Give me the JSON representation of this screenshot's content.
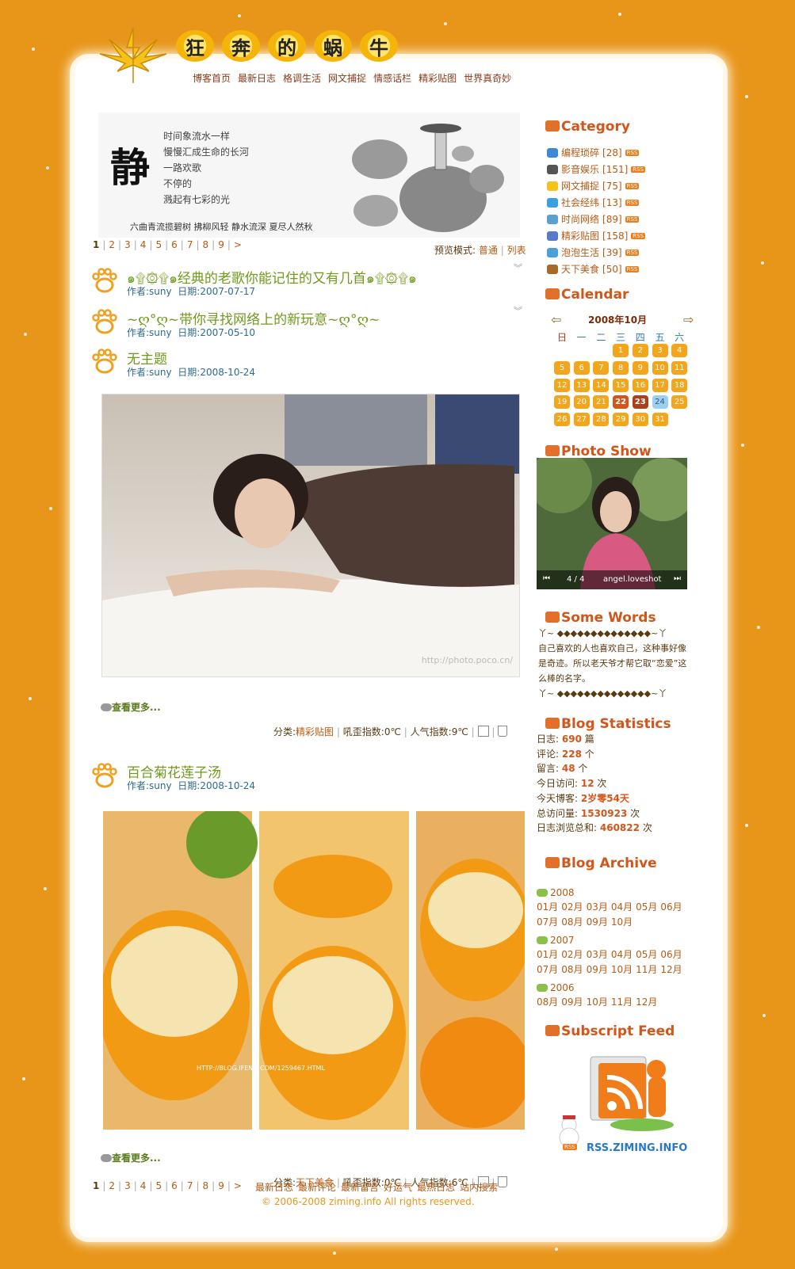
{
  "site": {
    "title_chars": [
      "狂",
      "奔",
      "的",
      "蜗",
      "牛"
    ],
    "nav": [
      "博客首页",
      "最新日志",
      "格调生活",
      "网文捕捉",
      "情感话栏",
      "精彩贴图",
      "世界真奇妙"
    ]
  },
  "banner": {
    "big_char": "静",
    "poem": "时间象流水一样\n慢慢汇成生命的长河\n一路欢歌\n不停的\n溅起有七彩的光",
    "footer": "六曲青流揽碧树  拂柳风轻  静水流深  夏尽人然秋"
  },
  "pager_top": {
    "pages": [
      "1",
      "2",
      "3",
      "4",
      "5",
      "6",
      "7",
      "8",
      "9",
      ">"
    ],
    "active": "1"
  },
  "view_mode": {
    "label": "预览模式:",
    "normal": "普通",
    "list": "列表"
  },
  "posts": [
    {
      "title": "๑۩۞۩๑经典的老歌你能记住的又有几首๑۩۞۩๑",
      "author_label": "作者:",
      "author": "suny",
      "date_label": "日期:",
      "date": "2007-07-17"
    },
    {
      "title": "~ღ°ღ~带你寻找网络上的新玩意~ღ°ღ~",
      "author_label": "作者:",
      "author": "suny",
      "date_label": "日期:",
      "date": "2007-05-10"
    },
    {
      "title": "无主题",
      "author_label": "作者:",
      "author": "suny",
      "date_label": "日期:",
      "date": "2008-10-24",
      "watermark": "http://photo.poco.cn/",
      "more": "查看更多...",
      "footer": {
        "cat_label": "分类:",
        "cat": "精彩贴图",
        "a_label": "吼歪指数:",
        "a": "0℃",
        "b_label": "人气指数:",
        "b": "9℃"
      }
    },
    {
      "title": "百合菊花莲子汤",
      "author_label": "作者:",
      "author": "suny",
      "date_label": "日期:",
      "date": "2008-10-24",
      "watermark": "HTTP://BLOG.IFENG.COM/1259467.HTML",
      "more": "查看更多...",
      "footer": {
        "cat_label": "分类:",
        "cat": "天下美食",
        "a_label": "吼歪指数:",
        "a": "0℃",
        "b_label": "人气指数:",
        "b": "6℃"
      }
    }
  ],
  "sidebar": {
    "category": {
      "title": "Category",
      "items": [
        {
          "name": "编程琐碎",
          "count": "[28]",
          "color": "#3a8ad6"
        },
        {
          "name": "影音娱乐",
          "count": "[151]",
          "color": "#555555"
        },
        {
          "name": "网文捕捉",
          "count": "[75]",
          "color": "#f5c21a"
        },
        {
          "name": "社会经纬",
          "count": "[13]",
          "color": "#3aa0e0"
        },
        {
          "name": "时尚网络",
          "count": "[89]",
          "color": "#5aa0d0"
        },
        {
          "name": "精彩贴图",
          "count": "[158]",
          "color": "#5a7ac8"
        },
        {
          "name": "泡泡生活",
          "count": "[39]",
          "color": "#4aa0d8"
        },
        {
          "name": "天下美食",
          "count": "[50]",
          "color": "#a86a2a"
        }
      ],
      "rss_label": "RSS"
    },
    "calendar": {
      "title": "Calendar",
      "month": "2008年10月",
      "weekdays": [
        "日",
        "一",
        "二",
        "三",
        "四",
        "五",
        "六"
      ],
      "first_weekday": 3,
      "days": 31,
      "highlight_strong": 22,
      "highlight_dark": 23,
      "today": 24
    },
    "photo_show": {
      "title": "Photo Show",
      "counter": "4 / 4",
      "caption": "angel.loveshot"
    },
    "some_words": {
      "title": "Some Words",
      "line1": "丫~ ◆◆◆◆◆◆◆◆◆◆◆◆◆◆~丫",
      "text": "自己喜欢的人也喜欢自己，这种事好像是奇迹。所以老天爷才帮它取“恋爱”这么棒的名字。",
      "line2": "丫~ ◆◆◆◆◆◆◆◆◆◆◆◆◆◆~丫"
    },
    "stats": {
      "title": "Blog Statistics",
      "rows": [
        {
          "label": "日志:",
          "value": "690",
          "unit": "篇"
        },
        {
          "label": "评论:",
          "value": "228",
          "unit": "个"
        },
        {
          "label": "留言:",
          "value": "48",
          "unit": "个"
        },
        {
          "label": "今日访问:",
          "value": "12",
          "unit": "次"
        },
        {
          "label": "今天博客:",
          "value": "2岁零54天",
          "unit": ""
        },
        {
          "label": "总访问量:",
          "value": "1530923",
          "unit": "次"
        },
        {
          "label": "日志浏览总和:",
          "value": "460822",
          "unit": "次"
        }
      ]
    },
    "archive": {
      "title": "Blog Archive",
      "years": [
        {
          "year": "2008",
          "months": [
            "01月",
            "02月",
            "03月",
            "04月",
            "05月",
            "06月",
            "07月",
            "08月",
            "09月",
            "10月"
          ]
        },
        {
          "year": "2007",
          "months": [
            "01月",
            "02月",
            "03月",
            "04月",
            "05月",
            "06月",
            "07月",
            "08月",
            "09月",
            "10月",
            "11月",
            "12月"
          ]
        },
        {
          "year": "2006",
          "months": [
            "08月",
            "09月",
            "10月",
            "11月",
            "12月"
          ]
        }
      ]
    },
    "feed": {
      "title": "Subscript Feed",
      "logo_text": "RSS.ZIMING.INFO",
      "badge": "RSS"
    }
  },
  "footer": {
    "pages": [
      "1",
      "2",
      "3",
      "4",
      "5",
      "6",
      "7",
      "8",
      "9",
      ">"
    ],
    "links": [
      "最新日志",
      "最新评论",
      "最新留言",
      "好运气",
      "最热日志",
      "站内搜索"
    ],
    "copyright": "© 2006-2008 ziming.info All rights reserved."
  },
  "colors": {
    "background": "#e8961a",
    "accent": "#d2561a",
    "link": "#b65a14",
    "post_title": "#6f9a1c",
    "meta": "#2d6a94"
  }
}
